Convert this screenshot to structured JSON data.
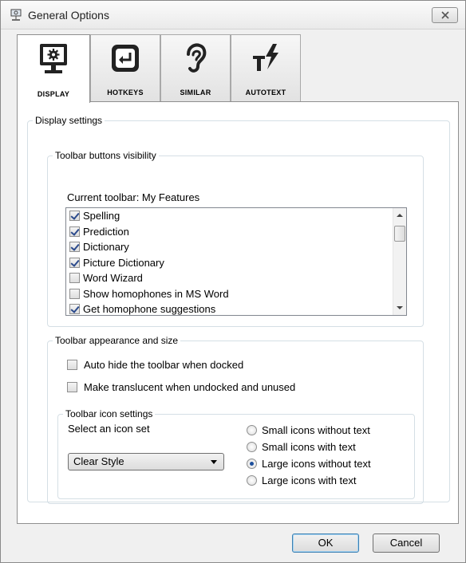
{
  "window": {
    "title": "General Options",
    "colors": {
      "accent": "#1d4f9c",
      "frame": "#f0f0f0",
      "panel": "#ffffff"
    }
  },
  "tabs": [
    {
      "label": "DISPLAY",
      "icon": "monitor-gear-icon",
      "active": true
    },
    {
      "label": "HOTKEYS",
      "icon": "enter-key-icon",
      "active": false
    },
    {
      "label": "SIMILAR",
      "icon": "ear-icon",
      "active": false
    },
    {
      "label": "AUTOTEXT",
      "icon": "text-lightning-icon",
      "active": false
    }
  ],
  "display_settings": {
    "legend": "Display settings",
    "visibility": {
      "legend": "Toolbar buttons visibility",
      "current_toolbar_label": "Current toolbar: My Features",
      "items": [
        {
          "label": "Spelling",
          "checked": true
        },
        {
          "label": "Prediction",
          "checked": true
        },
        {
          "label": "Dictionary",
          "checked": true
        },
        {
          "label": "Picture Dictionary",
          "checked": true
        },
        {
          "label": "Word Wizard",
          "checked": false
        },
        {
          "label": "Show homophones in MS Word",
          "checked": false
        },
        {
          "label": "Get homophone suggestions",
          "checked": true
        }
      ]
    },
    "appearance": {
      "legend": "Toolbar appearance and size",
      "auto_hide_label": "Auto hide the toolbar when docked",
      "auto_hide_checked": false,
      "translucent_label": "Make translucent when undocked and unused",
      "translucent_checked": false,
      "icon_settings": {
        "legend": "Toolbar icon settings",
        "select_label": "Select an icon set",
        "selected_icon_set": "Clear Style",
        "radio_options": [
          {
            "label": "Small icons without text",
            "checked": false
          },
          {
            "label": "Small icons with text",
            "checked": false
          },
          {
            "label": "Large icons without text",
            "checked": true
          },
          {
            "label": "Large icons with text",
            "checked": false
          }
        ]
      }
    }
  },
  "footer": {
    "ok_label": "OK",
    "cancel_label": "Cancel"
  }
}
